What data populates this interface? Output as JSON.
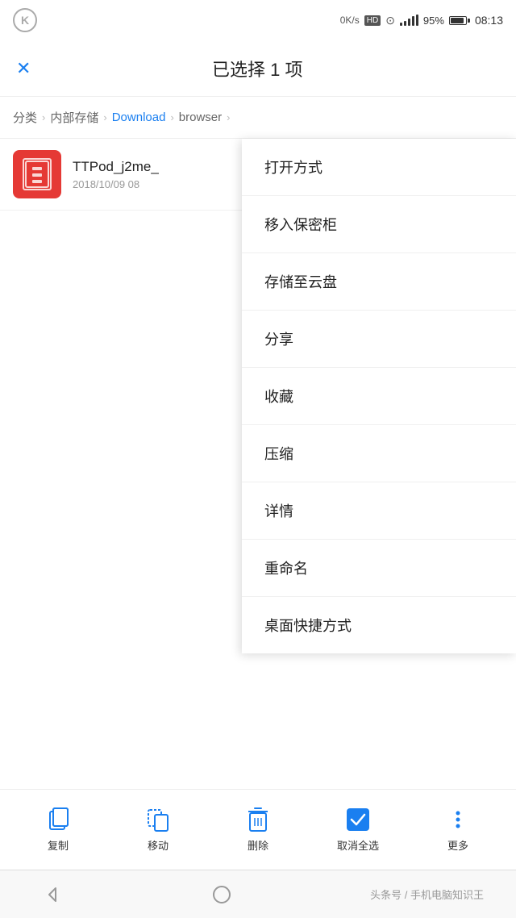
{
  "statusBar": {
    "speed": "0K/s",
    "hd": "HD",
    "battery": "95%",
    "time": "08:13"
  },
  "header": {
    "title": "已选择 1 项",
    "closeLabel": "×"
  },
  "breadcrumb": {
    "items": [
      "分类",
      "内部存储",
      "Download",
      "browser"
    ]
  },
  "file": {
    "name": "TTPod_j2me_",
    "date": "2018/10/09 08",
    "iconColor": "#e53935"
  },
  "contextMenu": {
    "items": [
      "打开方式",
      "移入保密柜",
      "存储至云盘",
      "分享",
      "收藏",
      "压缩",
      "详情",
      "重命名",
      "桌面快捷方式"
    ]
  },
  "toolbar": {
    "buttons": [
      {
        "id": "copy",
        "label": "复制",
        "icon": "copy"
      },
      {
        "id": "move",
        "label": "移动",
        "icon": "move"
      },
      {
        "id": "delete",
        "label": "删除",
        "icon": "delete"
      },
      {
        "id": "deselect",
        "label": "取消全选",
        "icon": "check"
      },
      {
        "id": "more",
        "label": "更多",
        "icon": "more"
      }
    ]
  },
  "navBar": {
    "centerText": "头条号 / 手机电脑知识王"
  }
}
